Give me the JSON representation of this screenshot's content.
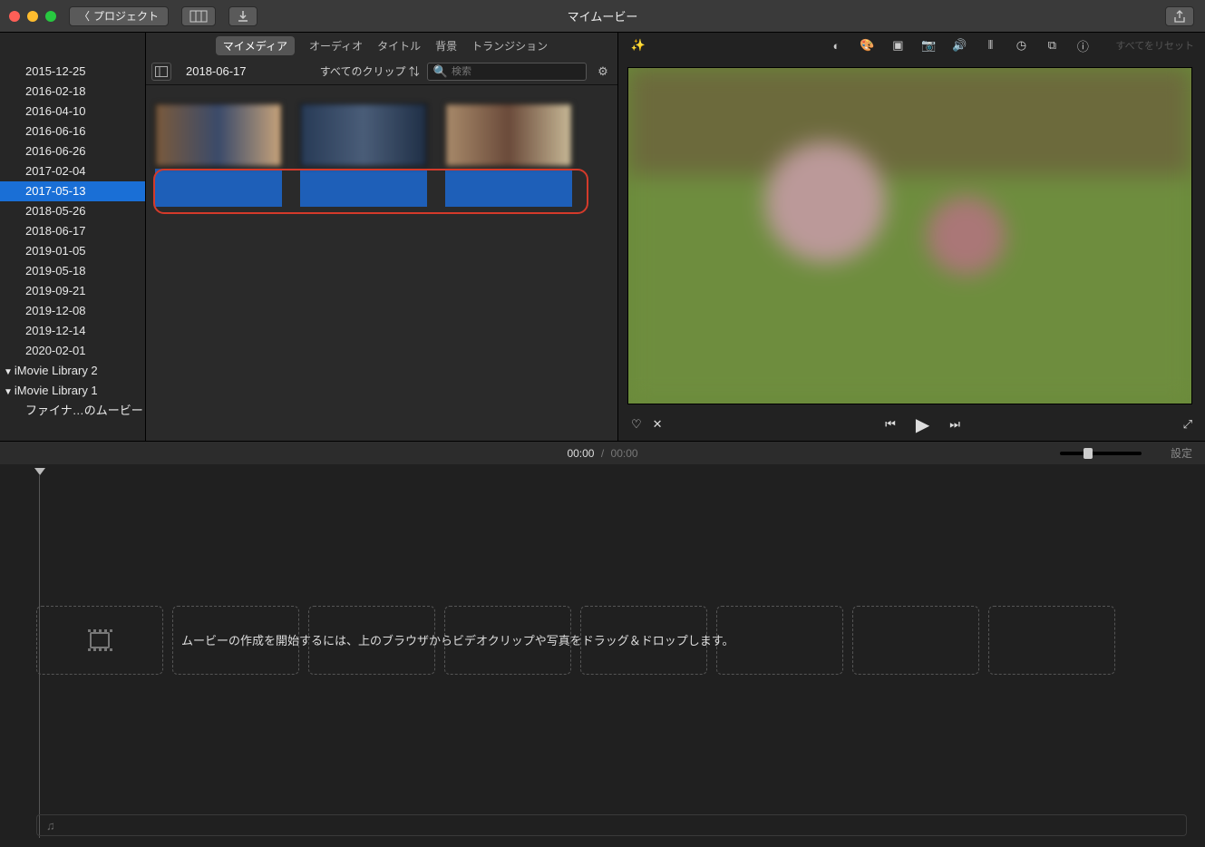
{
  "titlebar": {
    "project_button": "プロジェクト",
    "title": "マイムービー"
  },
  "sidebar": {
    "events": [
      "2015-12-25",
      "2016-02-18",
      "2016-04-10",
      "2016-06-16",
      "2016-06-26",
      "2017-02-04",
      "2017-05-13",
      "2018-05-26",
      "2018-06-17",
      "2019-01-05",
      "2019-05-18",
      "2019-09-21",
      "2019-12-08",
      "2019-12-14",
      "2020-02-01"
    ],
    "selected_index": 6,
    "libraries": [
      {
        "label": "iMovie Library 2"
      },
      {
        "label": "iMovie Library 1"
      }
    ],
    "sublib": "ファイナ…のムービー"
  },
  "tabs": {
    "items": [
      "マイメディア",
      "オーディオ",
      "タイトル",
      "背景",
      "トランジション"
    ],
    "active_index": 0
  },
  "browser_bar": {
    "event_title": "2018-06-17",
    "filter_label": "すべてのクリップ",
    "search_placeholder": "検索"
  },
  "viewer": {
    "reset_label": "すべてをリセット",
    "icons": [
      "contrast-icon",
      "color-icon",
      "crop-icon",
      "camera-icon",
      "volume-icon",
      "eq-icon",
      "speed-icon",
      "overlay-icon",
      "info-icon"
    ]
  },
  "timebar": {
    "current": "00:00",
    "separator": "/",
    "total": "00:00",
    "settings": "設定"
  },
  "timeline": {
    "hint": "ムービーの作成を開始するには、上のブラウザからビデオクリップや写真をドラッグ＆ドロップします。"
  }
}
